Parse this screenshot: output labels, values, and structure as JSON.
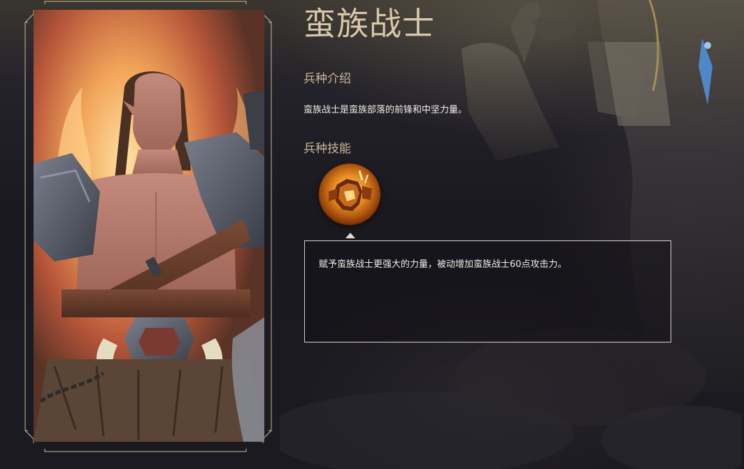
{
  "unit": {
    "name": "蛮族战士",
    "intro_heading": "兵种介绍",
    "intro_text": "蛮族战士是蛮族部落的前锋和中坚力量。",
    "skills_heading": "兵种技能",
    "skills": [
      {
        "icon": "armored-warrior-skill-icon",
        "description": "赋予蛮族战士更强大的力量，被动增加蛮族战士60点攻击力。"
      }
    ]
  },
  "colors": {
    "title": "#d9c7a8",
    "heading": "#c9b79a",
    "body_text": "#f0ede6",
    "frame": "#cdbb96",
    "background": "#17161b"
  }
}
